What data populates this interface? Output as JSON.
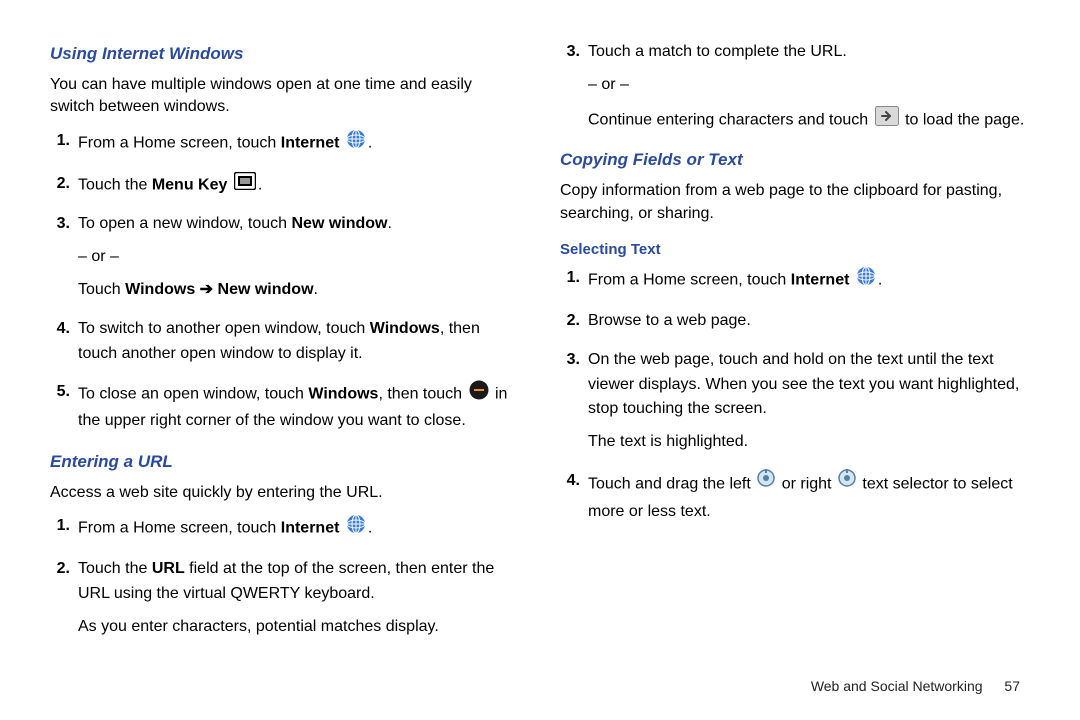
{
  "left": {
    "sec1": {
      "title": "Using Internet Windows",
      "intro": "You can have multiple windows open at one time and easily switch between windows.",
      "s1_a": "From a Home screen, touch ",
      "s1_b": "Internet",
      "s2_a": "Touch the ",
      "s2_b": "Menu Key",
      "s3_a": "To open a new window, touch ",
      "s3_b": "New window",
      "s3_or": "– or –",
      "s3_c": "Touch ",
      "s3_d": "Windows ➔ New window",
      "s4_a": "To switch to another open window, touch ",
      "s4_b": "Windows",
      "s4_c": ", then touch another open window to display it.",
      "s5_a": "To close an open window, touch ",
      "s5_b": "Windows",
      "s5_c": ", then touch ",
      "s5_d": " in the upper right corner of the window you want to close."
    },
    "sec2": {
      "title": "Entering a URL",
      "intro": "Access a web site quickly by entering the URL.",
      "s1_a": "From a Home screen, touch ",
      "s1_b": "Internet",
      "s2_a": "Touch the ",
      "s2_b": "URL",
      "s2_c": " field at the top of the screen, then enter the URL using the virtual QWERTY keyboard.",
      "s2_d": "As you enter characters, potential matches display."
    }
  },
  "right": {
    "s3_a": "Touch a match to complete the URL.",
    "s3_or": "– or –",
    "s3_b": "Continue entering characters and touch ",
    "s3_c": " to load the page.",
    "sec1": {
      "title": "Copying Fields or Text",
      "intro": "Copy information from a web page to the clipboard for pasting, searching, or sharing.",
      "sub": "Selecting Text",
      "s1_a": "From a Home screen, touch ",
      "s1_b": "Internet",
      "s2": "Browse to a web page.",
      "s3_a": "On the web page, touch and hold on the text until the text viewer displays. When you see the text you want highlighted, stop touching the screen.",
      "s3_b": "The text is highlighted.",
      "s4_a": "Touch and drag the left ",
      "s4_b": " or right ",
      "s4_c": " text selector to select more or less text."
    }
  },
  "footer": {
    "section": "Web and Social Networking",
    "page": "57"
  }
}
